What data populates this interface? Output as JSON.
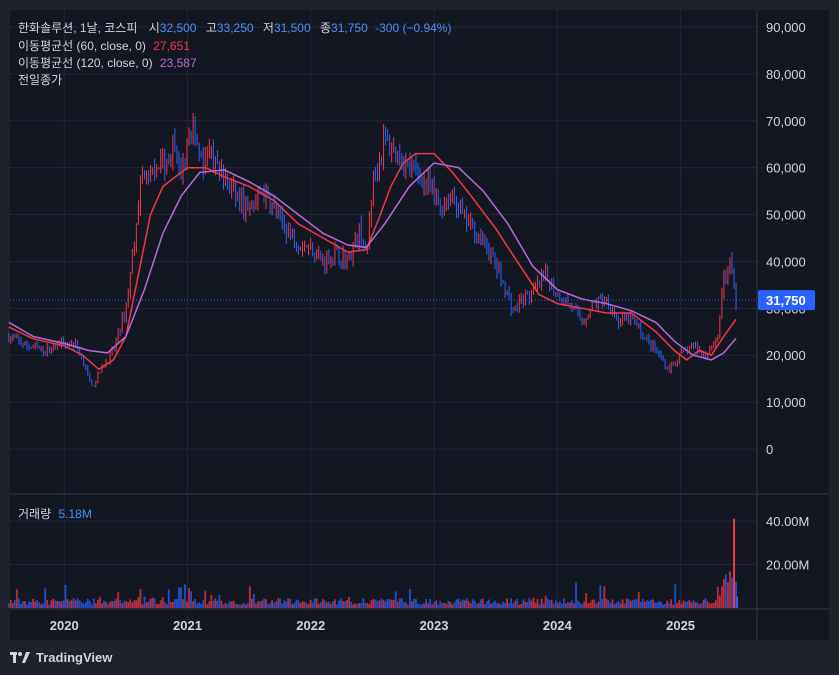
{
  "header": {
    "symbol": "한화솔루션, 1날, 코스피",
    "o_label": "시",
    "o_value": "32,500",
    "h_label": "고",
    "h_value": "33,250",
    "l_label": "저",
    "l_value": "31,500",
    "c_label": "종",
    "c_value": "31,750",
    "change": "-300 (−0.94%)"
  },
  "indicators": [
    {
      "label": "이동평균선 (60, close, 0)",
      "value": "27,651",
      "color": "#f23645"
    },
    {
      "label": "이동평균선 (120, close, 0)",
      "value": "23,587",
      "color": "#b668d6"
    }
  ],
  "prev_close_label": "전일종가",
  "volume_label": "거래량",
  "volume_value": "5.18M",
  "last_price_badge": "31,750",
  "brand": "TradingView",
  "colors": {
    "up": "#f23645",
    "down": "#2962ff",
    "ma60": "#f23645",
    "ma120": "#b668d6",
    "badge": "#2962ff",
    "bg": "#131722",
    "frame": "#1e222d"
  },
  "chart_data": {
    "type": "line",
    "title": "한화솔루션, 1날, 코스피",
    "price_axis": {
      "ticks": [
        0,
        10000,
        20000,
        30000,
        40000,
        50000,
        60000,
        70000,
        80000,
        90000
      ],
      "labels": [
        "0",
        "10,000",
        "20,000",
        "30,000",
        "40,000",
        "50,000",
        "60,000",
        "70,000",
        "80,000",
        "90,000"
      ]
    },
    "volume_axis": {
      "ticks": [
        20000000,
        40000000
      ],
      "labels": [
        "20.00M",
        "40.00M"
      ]
    },
    "x_labels": [
      {
        "t": 2020.0,
        "label": "2020"
      },
      {
        "t": 2021.0,
        "label": "2021"
      },
      {
        "t": 2022.0,
        "label": "2022"
      },
      {
        "t": 2023.0,
        "label": "2023"
      },
      {
        "t": 2024.0,
        "label": "2024"
      },
      {
        "t": 2025.0,
        "label": "2025"
      }
    ],
    "last_price": 31750,
    "series": [
      {
        "name": "한화솔루션",
        "x": [
          2019.55,
          2019.7,
          2019.85,
          2020.0,
          2020.1,
          2020.17,
          2020.22,
          2020.3,
          2020.4,
          2020.5,
          2020.55,
          2020.62,
          2020.7,
          2020.75,
          2020.8,
          2020.88,
          2020.95,
          2021.05,
          2021.12,
          2021.2,
          2021.3,
          2021.4,
          2021.5,
          2021.6,
          2021.7,
          2021.8,
          2021.9,
          2022.0,
          2022.1,
          2022.2,
          2022.3,
          2022.4,
          2022.45,
          2022.5,
          2022.6,
          2022.65,
          2022.7,
          2022.8,
          2022.9,
          2023.0,
          2023.05,
          2023.15,
          2023.25,
          2023.35,
          2023.45,
          2023.55,
          2023.65,
          2023.7,
          2023.8,
          2023.9,
          2024.0,
          2024.1,
          2024.2,
          2024.3,
          2024.4,
          2024.5,
          2024.6,
          2024.7,
          2024.8,
          2024.9,
          2025.0,
          2025.1,
          2025.2,
          2025.3,
          2025.35,
          2025.4,
          2025.45
        ],
        "values": [
          24000,
          22000,
          21000,
          23000,
          22000,
          18000,
          13000,
          17000,
          21000,
          30000,
          40000,
          58000,
          57000,
          62000,
          60000,
          64000,
          59000,
          70000,
          60000,
          63000,
          57000,
          54000,
          50000,
          55000,
          51000,
          47000,
          44000,
          43000,
          40000,
          42000,
          40000,
          47000,
          40000,
          57000,
          66000,
          64000,
          63000,
          60000,
          58000,
          54000,
          52000,
          54000,
          49000,
          46000,
          42000,
          36000,
          29000,
          32000,
          33000,
          37000,
          33000,
          31000,
          27000,
          31000,
          32000,
          27000,
          28000,
          24000,
          21000,
          17000,
          20000,
          22000,
          20000,
          24000,
          36000,
          40000,
          31750
        ]
      },
      {
        "name": "이동평균선 (60, close, 0)",
        "x": [
          2019.55,
          2019.75,
          2020.0,
          2020.15,
          2020.28,
          2020.4,
          2020.5,
          2020.6,
          2020.7,
          2020.8,
          2020.9,
          2021.0,
          2021.15,
          2021.3,
          2021.5,
          2021.7,
          2021.9,
          2022.1,
          2022.3,
          2022.45,
          2022.55,
          2022.65,
          2022.75,
          2022.85,
          2023.0,
          2023.15,
          2023.3,
          2023.5,
          2023.7,
          2023.85,
          2024.0,
          2024.2,
          2024.4,
          2024.6,
          2024.8,
          2024.95,
          2025.05,
          2025.15,
          2025.25,
          2025.35,
          2025.45
        ],
        "values": [
          26000,
          23500,
          22000,
          20000,
          17000,
          19000,
          24000,
          37000,
          50000,
          56000,
          58000,
          60000,
          60000,
          58000,
          56000,
          53000,
          48000,
          45000,
          42000,
          42500,
          49000,
          56000,
          61000,
          63000,
          63000,
          59000,
          54000,
          47000,
          39000,
          33000,
          31000,
          30000,
          29000,
          29000,
          25000,
          21000,
          19000,
          21000,
          20000,
          24000,
          27651
        ]
      },
      {
        "name": "이동평균선 (120, close, 0)",
        "x": [
          2019.55,
          2019.75,
          2020.0,
          2020.2,
          2020.35,
          2020.5,
          2020.65,
          2020.8,
          2020.95,
          2021.1,
          2021.3,
          2021.5,
          2021.7,
          2021.9,
          2022.1,
          2022.3,
          2022.45,
          2022.6,
          2022.8,
          2023.0,
          2023.2,
          2023.4,
          2023.6,
          2023.8,
          2024.0,
          2024.2,
          2024.4,
          2024.6,
          2024.8,
          2024.95,
          2025.1,
          2025.25,
          2025.35,
          2025.45
        ],
        "values": [
          27000,
          24000,
          22500,
          21000,
          20500,
          24000,
          34000,
          46000,
          54000,
          59000,
          59500,
          57000,
          54000,
          50000,
          46000,
          43500,
          43000,
          48000,
          56000,
          61000,
          60000,
          55000,
          48000,
          39000,
          34000,
          32000,
          31000,
          29500,
          27000,
          23000,
          20000,
          19000,
          20500,
          23587
        ]
      }
    ],
    "volume_series": {
      "name": "거래량",
      "last": 5180000
    },
    "grid": true,
    "legend": "top-left"
  }
}
